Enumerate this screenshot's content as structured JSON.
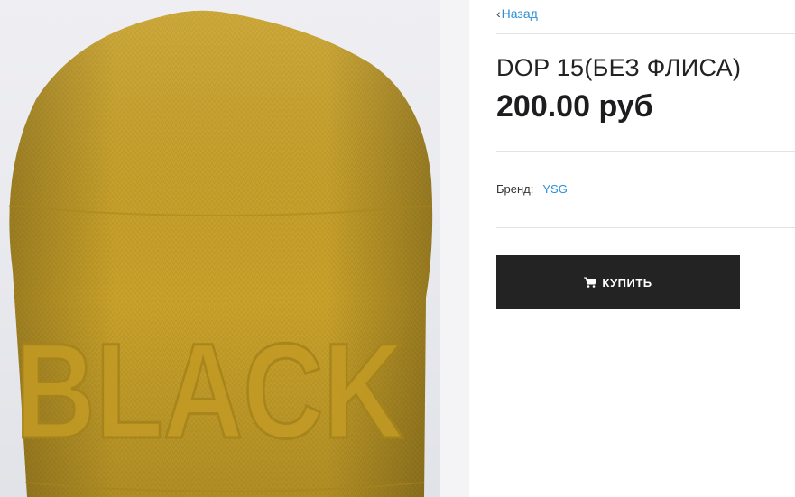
{
  "navigation": {
    "back_label": "Назад"
  },
  "product": {
    "title": "DOP 15(БЕЗ ФЛИСА)",
    "price": "200.00 руб",
    "brand_label": "Бренд:",
    "brand_value": "YSG",
    "image_text": "BLACK",
    "image_color": "#c9a22b"
  },
  "actions": {
    "buy_label": "КУПИТЬ",
    "buy_icon": "shopping-cart-icon"
  },
  "colors": {
    "link": "#2a8fd6",
    "button_bg": "#232323",
    "price": "#1d1d1f"
  }
}
